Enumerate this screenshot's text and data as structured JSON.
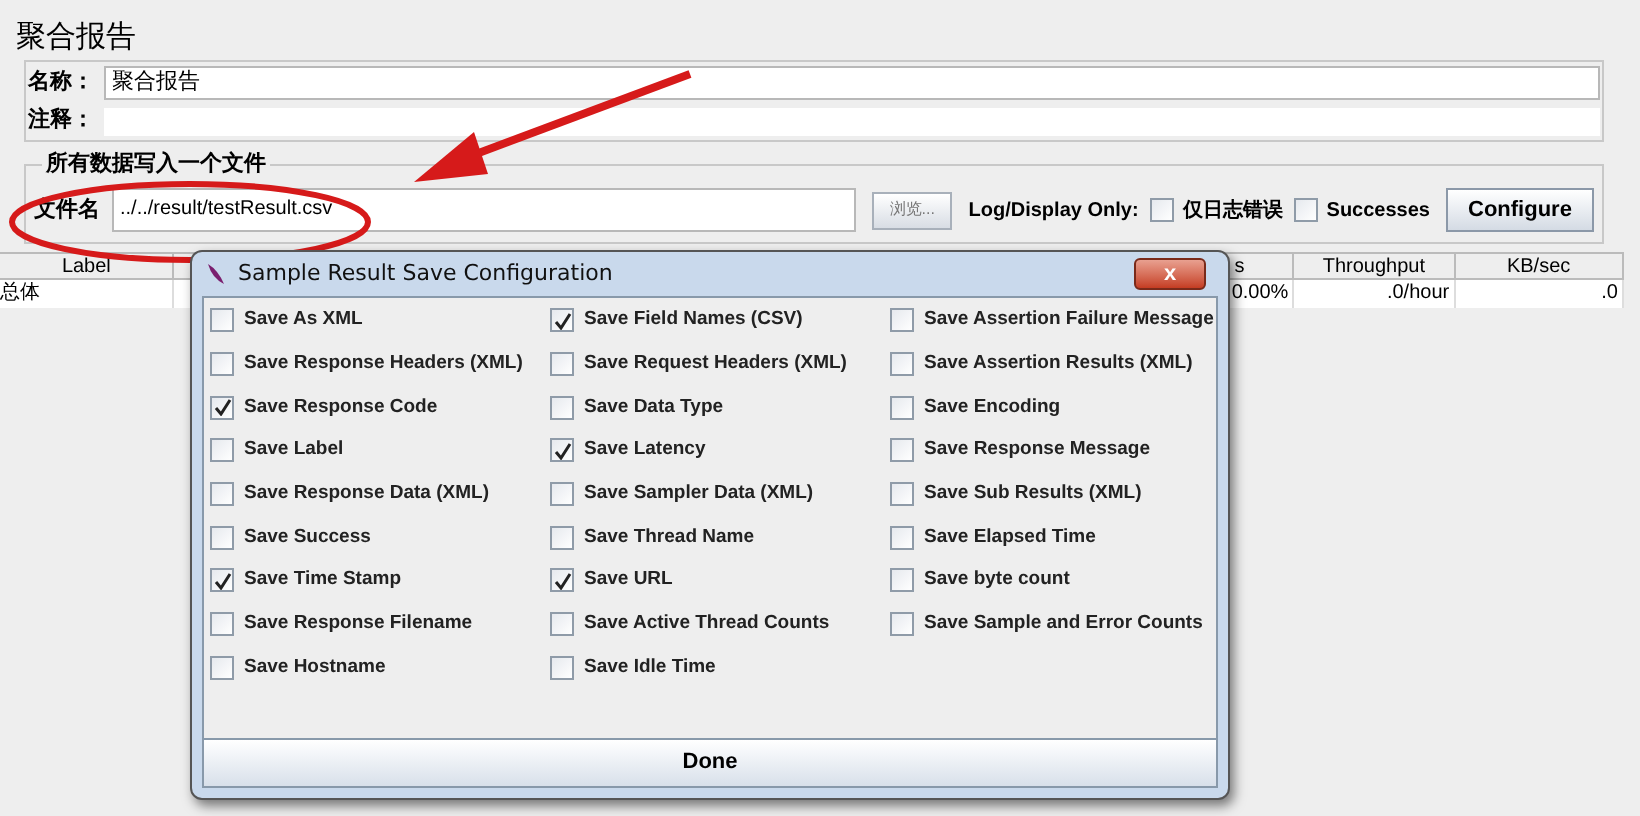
{
  "panel": {
    "title": "聚合报告",
    "name_label": "名称：",
    "name_value": "聚合报告",
    "comment_label": "注释：",
    "file_group": {
      "legend": "所有数据写入一个文件",
      "file_label": "文件名",
      "file_value": "../../result/testResult.csv",
      "browse_button": "浏览...",
      "log_label": "Log/Display Only:",
      "options": [
        {
          "label": "仅日志错误",
          "checked": false
        },
        {
          "label": "Successes",
          "checked": false
        }
      ],
      "configure_button": "Configure"
    }
  },
  "table": {
    "columns": [
      "Label",
      "s",
      "Throughput",
      "KB/sec"
    ],
    "rows": [
      [
        "总体",
        "0.00%",
        ".0/hour",
        ".0"
      ]
    ]
  },
  "dialog": {
    "title": "Sample Result Save Configuration",
    "close": "x",
    "options": [
      {
        "label": "Save As XML",
        "checked": false
      },
      {
        "label": "Save Field Names (CSV)",
        "checked": true
      },
      {
        "label": "Save Assertion Failure Message",
        "checked": false
      },
      {
        "label": "Save Response Headers (XML)",
        "checked": false
      },
      {
        "label": "Save Request Headers (XML)",
        "checked": false
      },
      {
        "label": "Save Assertion Results (XML)",
        "checked": false
      },
      {
        "label": "Save Response Code",
        "checked": true
      },
      {
        "label": "Save Data Type",
        "checked": false
      },
      {
        "label": "Save Encoding",
        "checked": false
      },
      {
        "label": "Save Label",
        "checked": false
      },
      {
        "label": "Save Latency",
        "checked": true
      },
      {
        "label": "Save Response Message",
        "checked": false
      },
      {
        "label": "Save Response Data (XML)",
        "checked": false
      },
      {
        "label": "Save Sampler Data (XML)",
        "checked": false
      },
      {
        "label": "Save Sub Results (XML)",
        "checked": false
      },
      {
        "label": "Save Success",
        "checked": false
      },
      {
        "label": "Save Thread Name",
        "checked": false
      },
      {
        "label": "Save Elapsed Time",
        "checked": false
      },
      {
        "label": "Save Time Stamp",
        "checked": true
      },
      {
        "label": "Save URL",
        "checked": true
      },
      {
        "label": "Save byte count",
        "checked": false
      },
      {
        "label": "Save Response Filename",
        "checked": false
      },
      {
        "label": "Save Active Thread Counts",
        "checked": false
      },
      {
        "label": "Save Sample and Error Counts",
        "checked": false
      },
      {
        "label": "Save Hostname",
        "checked": false
      },
      {
        "label": "Save Idle Time",
        "checked": false
      }
    ],
    "done_button": "Done"
  }
}
